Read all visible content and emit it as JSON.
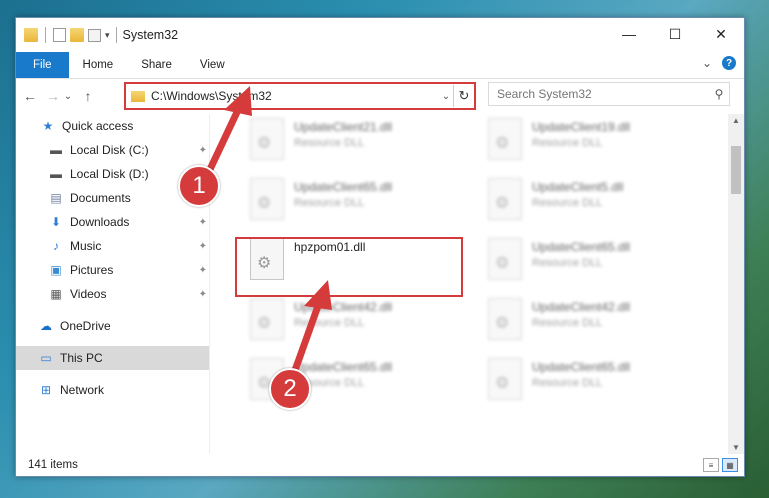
{
  "window": {
    "title": "System32",
    "controls": {
      "minimize": "—",
      "maximize": "☐",
      "close": "✕"
    }
  },
  "ribbon": {
    "tabs": [
      "File",
      "Home",
      "Share",
      "View"
    ],
    "expand_glyph": "⌄",
    "help_glyph": "?"
  },
  "nav": {
    "back": "←",
    "forward": "→",
    "recent": "⌄",
    "up": "↑",
    "address": "C:\\Windows\\System32",
    "address_dropdown": "⌄",
    "refresh": "↻",
    "search_placeholder": "Search System32"
  },
  "sidebar": {
    "items": [
      {
        "label": "Quick access",
        "icon": "star-icon",
        "glyph": "★",
        "color": "#2f7fd8"
      },
      {
        "label": "Local Disk (C:)",
        "icon": "drive-icon",
        "glyph": "▬",
        "color": "#555555",
        "pinned": true
      },
      {
        "label": "Local Disk (D:)",
        "icon": "drive-icon",
        "glyph": "▬",
        "color": "#555555"
      },
      {
        "label": "Documents",
        "icon": "document-icon",
        "glyph": "▤",
        "color": "#6b7d9a",
        "pinned": true
      },
      {
        "label": "Downloads",
        "icon": "download-icon",
        "glyph": "⬇",
        "color": "#2f7fd8",
        "pinned": true
      },
      {
        "label": "Music",
        "icon": "music-icon",
        "glyph": "♪",
        "color": "#2f7fd8",
        "pinned": true
      },
      {
        "label": "Pictures",
        "icon": "picture-icon",
        "glyph": "▣",
        "color": "#3b8ccf",
        "pinned": true
      },
      {
        "label": "Videos",
        "icon": "video-icon",
        "glyph": "▦",
        "color": "#555555",
        "pinned": true
      },
      {
        "label": "OneDrive",
        "icon": "cloud-icon",
        "glyph": "☁",
        "color": "#1a6fc9"
      },
      {
        "label": "This PC",
        "icon": "computer-icon",
        "glyph": "▭",
        "color": "#2f7fd8",
        "selected": true
      },
      {
        "label": "Network",
        "icon": "network-icon",
        "glyph": "⊞",
        "color": "#2f7fd8"
      }
    ],
    "pin_glyph": "📌"
  },
  "files": [
    {
      "name": "UpdateClient21.dll",
      "desc": "Resource DLL",
      "blurred": true
    },
    {
      "name": "UpdateClient19.dll",
      "desc": "Resource DLL",
      "blurred": true
    },
    {
      "name": "UpdateClient65.dll",
      "desc": "Resource DLL",
      "blurred": true
    },
    {
      "name": "UpdateClient5.dll",
      "desc": "Resource DLL",
      "blurred": true
    },
    {
      "name": "hpzpom01.dll",
      "desc": "",
      "blurred": false
    },
    {
      "name": "UpdateClient65.dll",
      "desc": "Resource DLL",
      "blurred": true
    },
    {
      "name": "UpdateClient42.dll",
      "desc": "Resource DLL",
      "blurred": true
    },
    {
      "name": "UpdateClient42.dll",
      "desc": "Resource DLL",
      "blurred": true
    },
    {
      "name": "UpdateClient65.dll",
      "desc": "Resource DLL",
      "blurred": true
    },
    {
      "name": "UpdateClient65.dll",
      "desc": "Resource DLL",
      "blurred": true
    }
  ],
  "status": {
    "count": "141 items"
  },
  "callouts": {
    "one": "1",
    "two": "2"
  },
  "accent_red": "#d63b3b",
  "accent_blue": "#1979ca"
}
